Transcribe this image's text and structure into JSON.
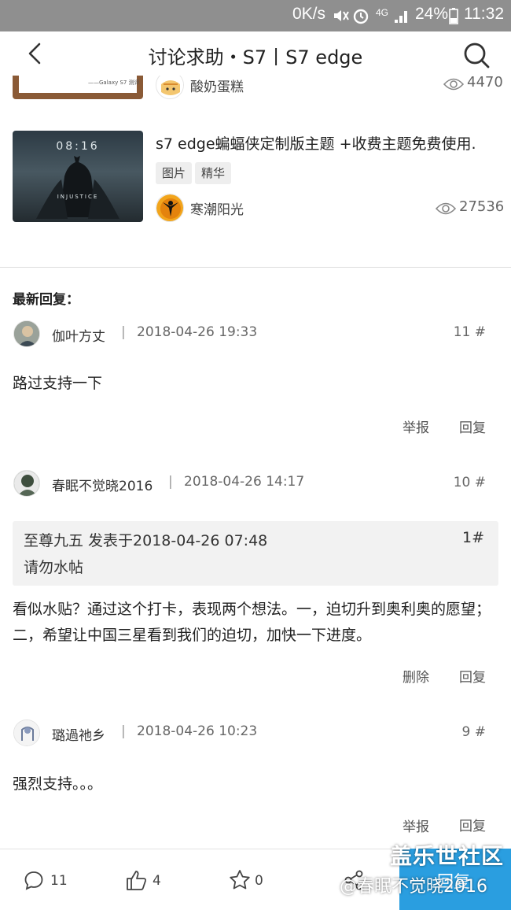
{
  "status_bar": {
    "net_speed": "0K/s",
    "network": "4G",
    "battery": "24%",
    "time": "11:32"
  },
  "header": {
    "title": "讨论求助・S7丨S7 edge"
  },
  "posts": [
    {
      "thumb_text": "——Galaxy S7 测评",
      "author": "酸奶蛋糕",
      "views": "4470"
    },
    {
      "title": "s7 edge蝙蝠侠定制版主题 +收费主题免费使用.",
      "tags": [
        "图片",
        "精华"
      ],
      "thumb_clock": "08:16",
      "thumb_brand": "INJUSTICE",
      "author": "寒潮阳光",
      "views": "27536"
    }
  ],
  "latest_replies_label": "最新回复：",
  "replies": [
    {
      "name": "伽叶方丈",
      "separator": "|",
      "time": "2018-04-26 19:33",
      "floor": "11 #",
      "body": "路过支持一下",
      "actions": [
        "举报",
        "回复"
      ]
    },
    {
      "name": "春眠不觉晓2016",
      "separator": "|",
      "time": "2018-04-26 14:17",
      "floor": "10 #",
      "quote": {
        "header": "至尊九五 发表于2018-04-26 07:48",
        "floor": "1#",
        "text": "请勿水帖"
      },
      "body": "看似水贴？通过这个打卡，表现两个想法。一，迫切升到奥利奥的愿望；二，希望让中国三星看到我们的迫切，加快一下进度。",
      "actions": [
        "删除",
        "回复"
      ]
    },
    {
      "name": "璐過祂乡",
      "separator": "|",
      "time": "2018-04-26 10:23",
      "floor": "9 #",
      "body": "强烈支持。。。",
      "actions": [
        "举报",
        "回复"
      ]
    }
  ],
  "bottom_bar": {
    "comments": "11",
    "likes": "4",
    "favorites": "0",
    "reply_label": "回复"
  },
  "watermark": {
    "site": "盖乐世社区",
    "user": "@春眠不觉晓2016"
  },
  "colors": {
    "status_bar": "#8f8f8f",
    "accent": "#2a9ee0"
  }
}
